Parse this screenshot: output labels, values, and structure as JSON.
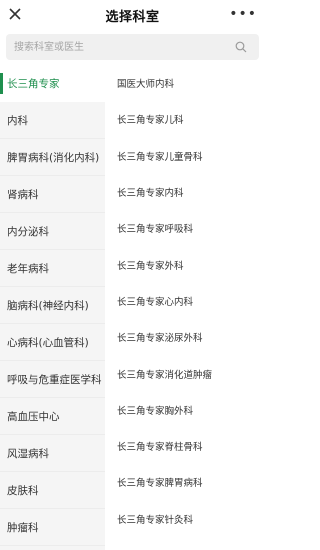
{
  "header": {
    "title": "选择科室",
    "more_label": "•••"
  },
  "search": {
    "placeholder": "搜索科室或医生"
  },
  "categories": [
    {
      "label": "长三角专家",
      "active": true
    },
    {
      "label": "内科"
    },
    {
      "label": "脾胃病科(消化内科)"
    },
    {
      "label": "肾病科"
    },
    {
      "label": "内分泌科"
    },
    {
      "label": "老年病科"
    },
    {
      "label": "脑病科(神经内科)"
    },
    {
      "label": "心病科(心血管科)"
    },
    {
      "label": "呼吸与危重症医学科"
    },
    {
      "label": "高血压中心"
    },
    {
      "label": "风湿病科"
    },
    {
      "label": "皮肤科"
    },
    {
      "label": "肿瘤科"
    }
  ],
  "departments": [
    "国医大师内科",
    "长三角专家儿科",
    "长三角专家儿童骨科",
    "长三角专家内科",
    "长三角专家呼吸科",
    "长三角专家外科",
    "长三角专家心内科",
    "长三角专家泌尿外科",
    "长三角专家消化道肿瘤",
    "长三角专家胸外科",
    "长三角专家脊柱骨科",
    "长三角专家脾胃病科",
    "长三角专家针灸科"
  ],
  "colors": {
    "accent": "#1f8f4e",
    "sidebar_bg": "#f5f5f5"
  }
}
